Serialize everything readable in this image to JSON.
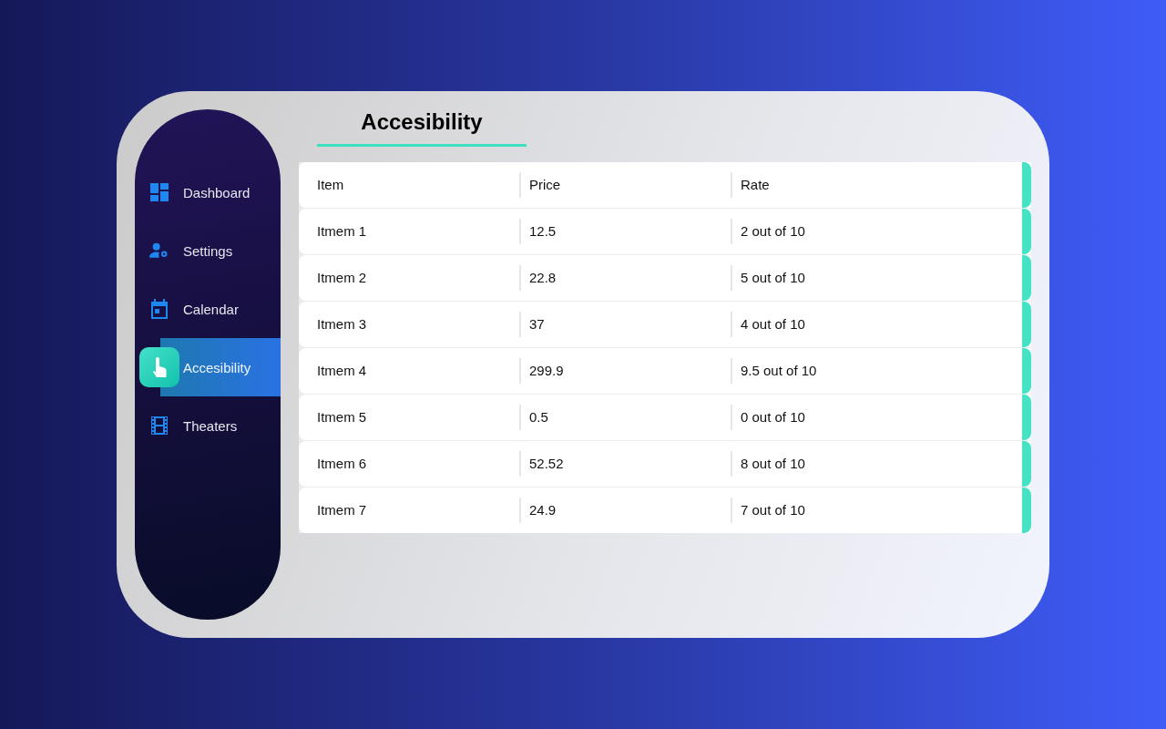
{
  "sidebar": {
    "items": [
      {
        "label": "Dashboard",
        "selected": false
      },
      {
        "label": "Settings",
        "selected": false
      },
      {
        "label": "Calendar",
        "selected": false
      },
      {
        "label": "Accesibility",
        "selected": true
      },
      {
        "label": "Theaters",
        "selected": false
      }
    ]
  },
  "page_title": "Accesibility",
  "table": {
    "columns": [
      "Item",
      "Price",
      "Rate"
    ],
    "rows": [
      [
        "Itmem 1",
        "12.5",
        "2 out of 10"
      ],
      [
        "Itmem 2",
        "22.8",
        "5 out of 10"
      ],
      [
        "Itmem 3",
        "37",
        "4 out of 10"
      ],
      [
        "Itmem 4",
        "299.9",
        "9.5 out of 10"
      ],
      [
        "Itmem 5",
        "0.5",
        "0 out of 10"
      ],
      [
        "Itmem 6",
        "52.52",
        "8 out of 10"
      ],
      [
        "Itmem 7",
        "24.9",
        "7 out of 10"
      ]
    ]
  }
}
